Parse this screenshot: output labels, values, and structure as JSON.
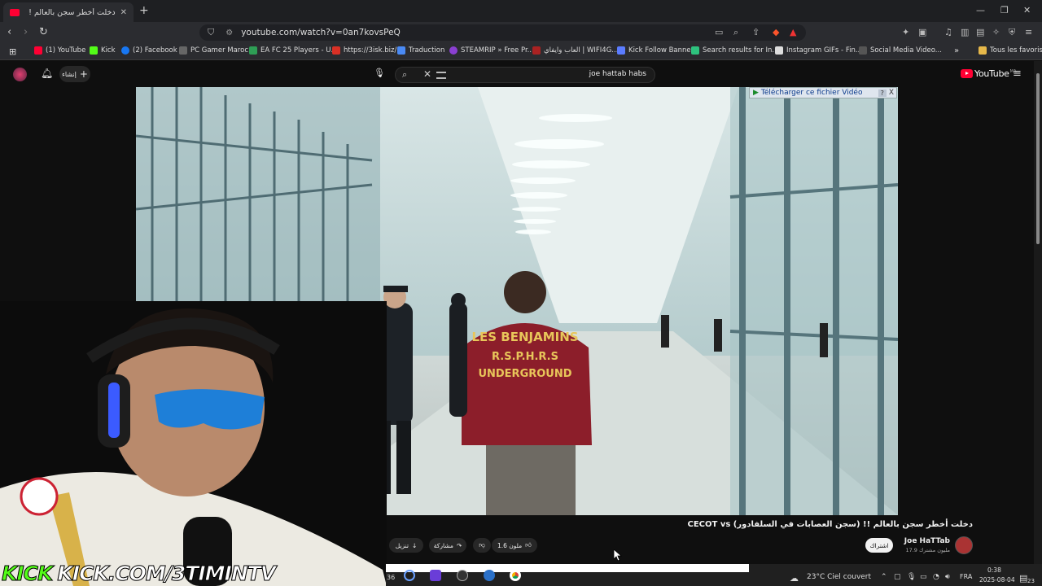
{
  "browser": {
    "tab_title": "دخلت أخطر سجن بالعالم !! (سجن",
    "tab_close": "✕",
    "new_tab": "+",
    "window_controls": {
      "minimize": "—",
      "restore": "❐",
      "close": "✕"
    },
    "url": "youtube.com/watch?v=0an7kovsPeQ"
  },
  "bookmarks": [
    {
      "label": "(1) YouTube",
      "color": "#ff0033"
    },
    {
      "label": "Kick",
      "color": "#53fc18"
    },
    {
      "label": "(2) Facebook",
      "color": "#1877f2"
    },
    {
      "label": "PC Gamer Maroc",
      "color": "#666666"
    },
    {
      "label": "EA FC 25 Players - U...",
      "color": "#2e9e55"
    },
    {
      "label": "https://3isk.biz/",
      "color": "#d93025"
    },
    {
      "label": "Traduction",
      "color": "#4a8af4"
    },
    {
      "label": "STEAMRIP » Free Pr...",
      "color": "#8a3fd1"
    },
    {
      "label": "العاب وايفاي | WIFI4G...",
      "color": "#aa2222"
    },
    {
      "label": "Kick Follow Banner",
      "color": "#5b7cff"
    },
    {
      "label": "Search results for In...",
      "color": "#2ec27e"
    },
    {
      "label": "Instagram GIFs - Fin...",
      "color": "#dddddd"
    },
    {
      "label": "Social Media Video...",
      "color": "#555555"
    },
    {
      "label": "Tous les favoris",
      "color": "#e6b84a"
    }
  ],
  "youtube": {
    "create_label": "إنشاء",
    "search_query": "joe hattab habs",
    "logo_text": "YouTube",
    "logo_region": "MA"
  },
  "download_bar": {
    "label": "Télécharger ce fichier Vidéo",
    "help": "?",
    "close": "X"
  },
  "video_shirt_text": {
    "line1": "LES BENJAMINS",
    "line2": "R.S.P.H.R.S",
    "line3": "UNDERGROUND"
  },
  "video_info": {
    "title": "دخلت أخطر سجن بالعالم !! (سجن العصابات في السلفادور) CECOT vs",
    "like_count": "1.6 ملون",
    "share_label": "مشاركة",
    "download_label": "تنزيل",
    "subscribe_label": "اشتراك",
    "channel_name": "Joe HaTTab",
    "subscribers": "17.9 مليون مشترك"
  },
  "stream_overlay": {
    "brand": "KICK",
    "url": "KICK.COM/3TIMINTV"
  },
  "taskbar": {
    "badge": "36",
    "weather": "23°C  Ciel couvert",
    "lang": "FRA",
    "time": "0:38",
    "date": "2025-08-04",
    "notif": "23"
  }
}
